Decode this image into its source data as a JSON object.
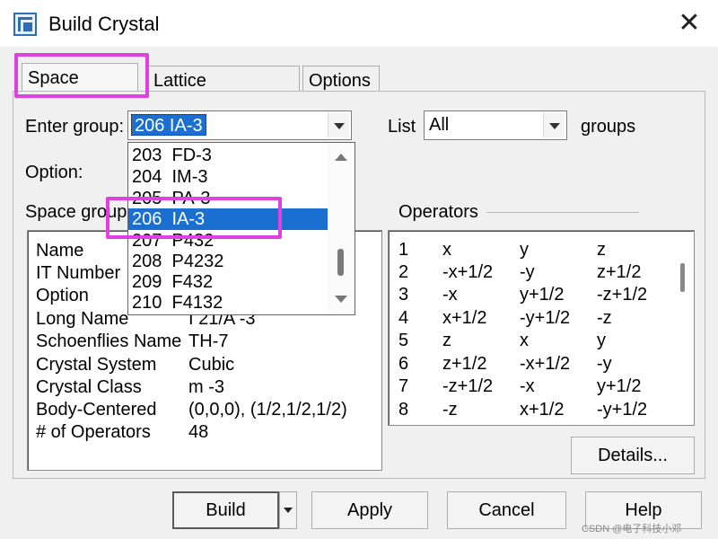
{
  "window": {
    "title": "Build Crystal",
    "close_glyph": "✕",
    "icon": "crystal-app-icon"
  },
  "tabs": [
    {
      "label": "Space Group",
      "active": true
    },
    {
      "label": "Lattice Parameters",
      "active": false
    },
    {
      "label": "Options",
      "active": false
    }
  ],
  "enter_group": {
    "label": "Enter group:",
    "value": "206  IA-3"
  },
  "list": {
    "label": "List",
    "value": "All",
    "suffix": "groups"
  },
  "option": {
    "label": "Option:"
  },
  "dropdown": {
    "items": [
      "203  FD-3",
      "204  IM-3",
      "205  PA-3",
      "206  IA-3",
      "207  P432",
      "208  P4232",
      "209  F432",
      "210  F4132"
    ],
    "selected_index": 3
  },
  "space_group_section": {
    "label": "Space group"
  },
  "space_group_info": [
    {
      "name": "Name",
      "value": ""
    },
    {
      "name": "IT Number",
      "value": ""
    },
    {
      "name": "Option",
      "value": ""
    },
    {
      "name": "Long Name",
      "value": "I 21/A -3"
    },
    {
      "name": "Schoenflies Name",
      "value": "TH-7"
    },
    {
      "name": "Crystal System",
      "value": "Cubic"
    },
    {
      "name": "Crystal Class",
      "value": "m -3"
    },
    {
      "name": "Body-Centered",
      "value": "(0,0,0), (1/2,1/2,1/2)"
    },
    {
      "name": "# of Operators",
      "value": "48"
    }
  ],
  "operators": {
    "label": "Operators",
    "rows": [
      {
        "n": "1",
        "x": "x",
        "y": "y",
        "z": "z"
      },
      {
        "n": "2",
        "x": "-x+1/2",
        "y": "-y",
        "z": "z+1/2"
      },
      {
        "n": "3",
        "x": "-x",
        "y": "y+1/2",
        "z": "-z+1/2"
      },
      {
        "n": "4",
        "x": "x+1/2",
        "y": "-y+1/2",
        "z": "-z"
      },
      {
        "n": "5",
        "x": "z",
        "y": "x",
        "z": "y"
      },
      {
        "n": "6",
        "x": "z+1/2",
        "y": "-x+1/2",
        "z": "-y"
      },
      {
        "n": "7",
        "x": "-z+1/2",
        "y": "-x",
        "z": "y+1/2"
      },
      {
        "n": "8",
        "x": "-z",
        "y": "x+1/2",
        "z": "-y+1/2"
      }
    ]
  },
  "buttons": {
    "details": "Details...",
    "build": "Build",
    "apply": "Apply",
    "cancel": "Cancel",
    "help": "Help"
  },
  "watermark": "CSDN @电子科技小邓",
  "colors": {
    "highlight": "#e040e0",
    "selection": "#1b6fd1",
    "dialog_bg": "#f0f0f0"
  }
}
